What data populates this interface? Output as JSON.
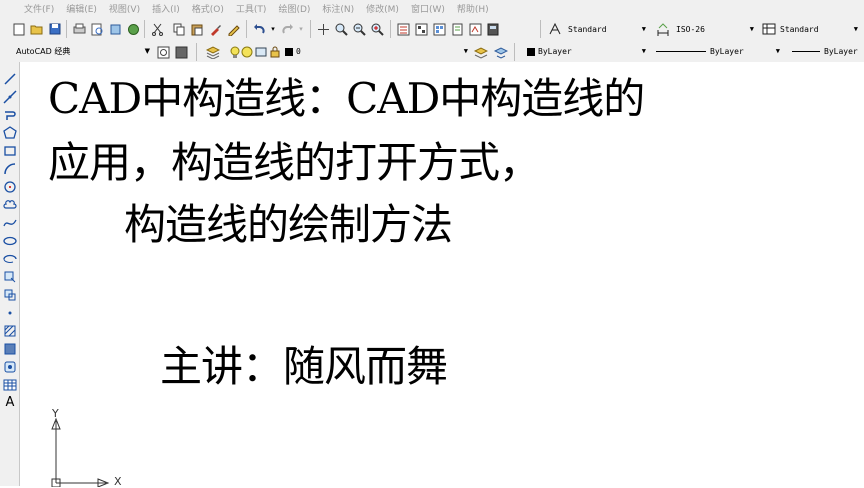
{
  "menu": {
    "items": [
      "文件(F)",
      "编辑(E)",
      "视图(V)",
      "插入(I)",
      "格式(O)",
      "工具(T)",
      "绘图(D)",
      "标注(N)",
      "修改(M)",
      "窗口(W)",
      "帮助(H)"
    ]
  },
  "styles_toolbar": {
    "text_style": "Standard",
    "dim_style": "ISO-26",
    "table_style": "Standard"
  },
  "workspace_toolbar": {
    "workspace": "AutoCAD 经典",
    "layer": "0",
    "color": "ByLayer",
    "linetype": "ByLayer",
    "lineweight": "ByLayer"
  },
  "drawing": {
    "lines": [
      "CAD中构造线：CAD中构造线的",
      "应用，构造线的打开方式，",
      "构造线的绘制方法",
      "主讲：随风而舞"
    ],
    "ucs": {
      "y_label": "Y",
      "x_label": "X"
    }
  },
  "left_toolbar": {
    "icons": [
      "line-icon",
      "construction-line-icon",
      "polyline-icon",
      "polygon-icon",
      "rectangle-icon",
      "arc-icon",
      "circle-icon",
      "revision-cloud-icon",
      "spline-icon",
      "ellipse-icon",
      "ellipse-arc-icon",
      "insert-block-icon",
      "make-block-icon",
      "point-icon",
      "hatch-icon",
      "gradient-icon",
      "region-icon",
      "table-icon",
      "multiline-text-icon"
    ],
    "text_label": "A"
  }
}
